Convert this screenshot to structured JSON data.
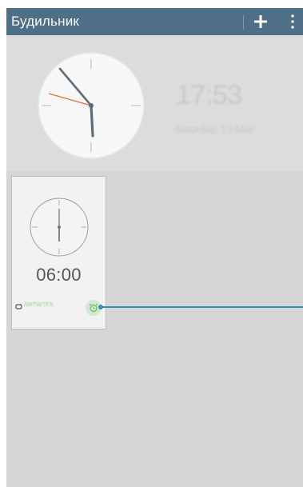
{
  "app": {
    "title": "Будильник"
  },
  "toolbar": {
    "add_icon": "plus-icon",
    "menu_icon": "more-vert-icon"
  },
  "header": {
    "time": "17:53",
    "date": "Saturday, 15 Mar"
  },
  "alarms": [
    {
      "time": "06:00",
      "days": "SMTWTFS",
      "repeat_icon": "repeat-icon",
      "toggle_icon": "alarm-clock-icon",
      "enabled": true
    }
  ],
  "colors": {
    "action_bar": "#4e6f86",
    "background": "#d6d6d6",
    "header_background": "#dcdcdc",
    "card_background": "#f2f2f2",
    "second_hand": "#f06a2a",
    "enabled_green": "#5cc05c",
    "callout": "#2f8fc2"
  }
}
